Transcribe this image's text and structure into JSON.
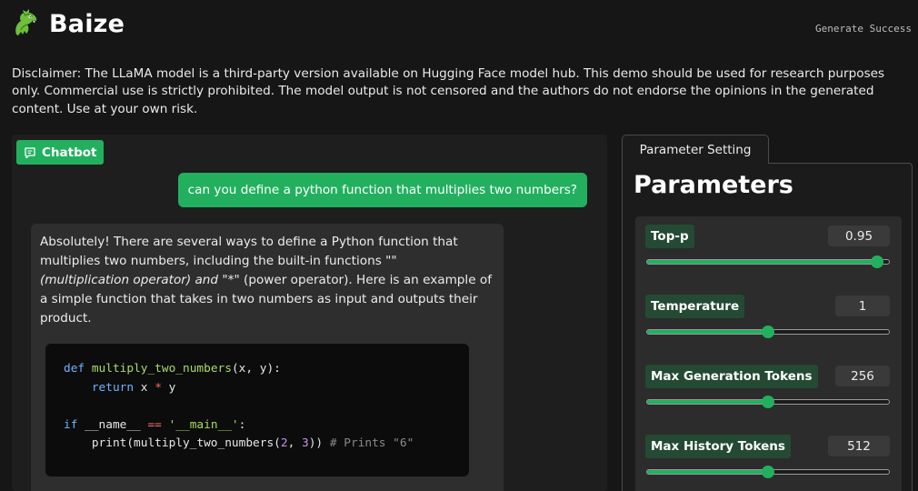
{
  "app": {
    "title": "Baize",
    "status": "Generate Success"
  },
  "disclaimer": "Disclaimer: The LLaMA model is a third-party version available on Hugging Face model hub. This demo should be used for research purposes only. Commercial use is strictly prohibited. The model output is not censored and the authors do not endorse the opinions in the generated content. Use at your own risk.",
  "chat": {
    "label": "Chatbot",
    "user_message": "can you define a python function that multiplies two numbers?",
    "bot_message": {
      "line1": "Absolutely! There are several ways to define a Python function that",
      "line2": "multiplies two numbers, including the built-in functions \"\"",
      "line3_italic": "(multiplication operator) and \"",
      "line3_rest": "*\" (power operator). Here is an example of",
      "line4": "a simple function that takes in two numbers as input and outputs their",
      "line5": "product."
    },
    "code": {
      "def_kw": "def",
      "func_name": "multiply_two_numbers",
      "params": "(x, y):",
      "indent": "    ",
      "return_kw": "return",
      "ret_x": " x ",
      "ret_op": "*",
      "ret_y": " y",
      "if_kw": "if",
      "name_var": " __name__ ",
      "eq_op": "==",
      "main_str": " '__main__'",
      "colon": ":",
      "print_call": "print(multiply_two_numbers(",
      "arg1": "2",
      "comma": ", ",
      "arg2": "3",
      "close": ")) ",
      "comment": "# Prints \"6\""
    }
  },
  "settings": {
    "tab_label": "Parameter Setting",
    "title": "Parameters",
    "params": [
      {
        "label": "Top-p",
        "value": "0.95",
        "fraction": 0.95
      },
      {
        "label": "Temperature",
        "value": "1",
        "fraction": 0.5
      },
      {
        "label": "Max Generation Tokens",
        "value": "256",
        "fraction": 0.5
      },
      {
        "label": "Max History Tokens",
        "value": "512",
        "fraction": 0.5
      }
    ]
  },
  "colors": {
    "accent": "#22b05f",
    "label_bg": "#244a33",
    "background": "#161616"
  },
  "icons": {
    "logo": "green-dragon-icon",
    "chat": "chat-bubble-icon"
  }
}
